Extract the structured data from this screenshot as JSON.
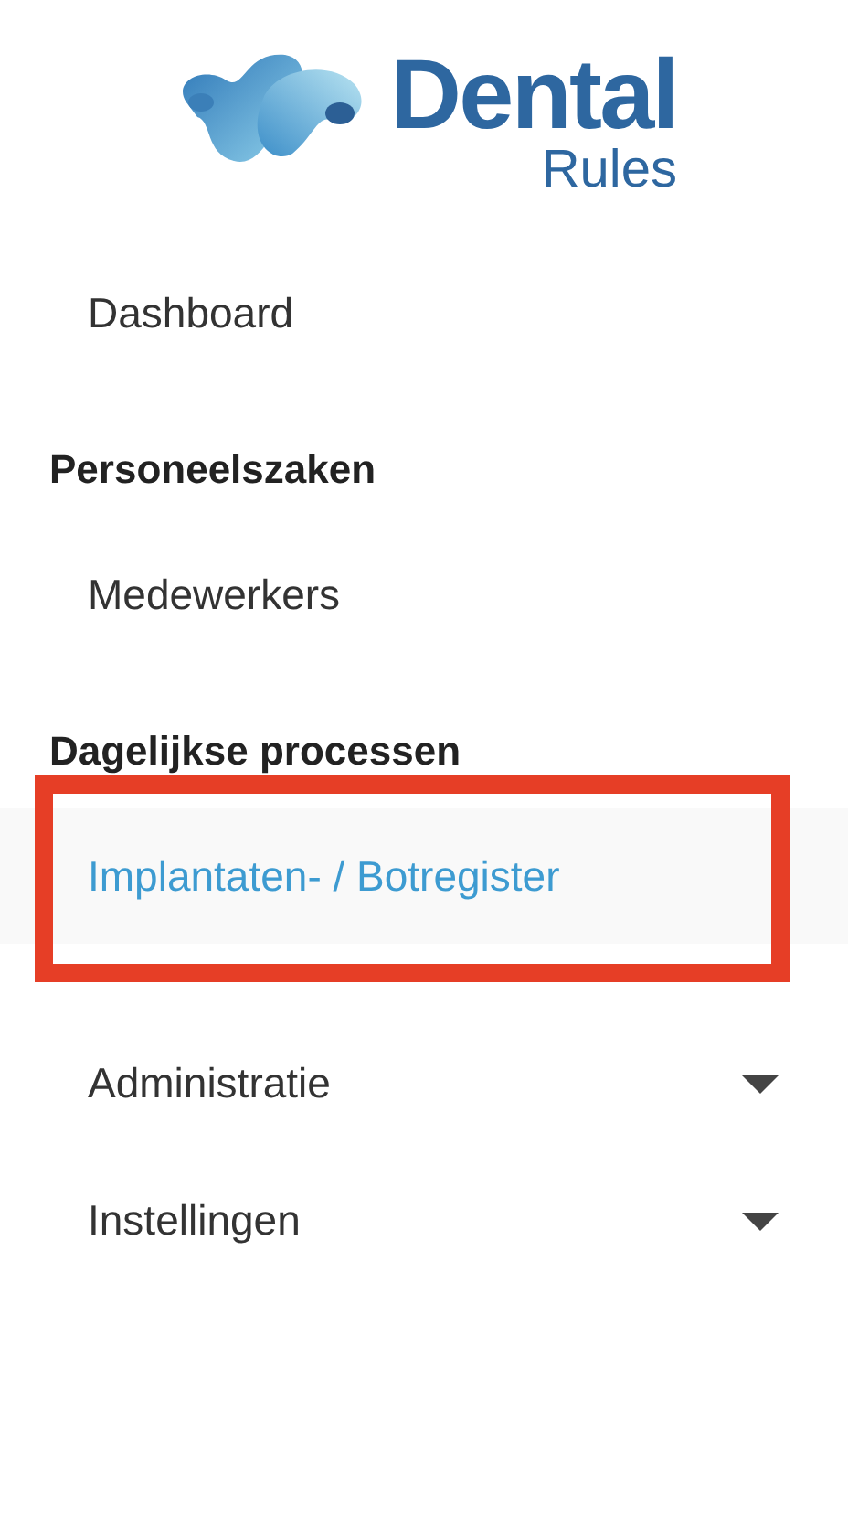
{
  "logo": {
    "title": "Dental",
    "subtitle": "Rules"
  },
  "nav": [
    {
      "kind": "link",
      "label": "Dashboard",
      "selected": false,
      "highlighted": false
    },
    {
      "kind": "heading",
      "label": "Personeelszaken"
    },
    {
      "kind": "link",
      "label": "Medewerkers",
      "selected": false,
      "highlighted": false
    },
    {
      "kind": "heading",
      "label": "Dagelijkse processen"
    },
    {
      "kind": "link",
      "label": "Implantaten- / Botregister",
      "selected": true,
      "highlighted": true
    }
  ],
  "menus": [
    {
      "label": "Administratie",
      "expanded": false
    },
    {
      "label": "Instellingen",
      "expanded": false
    }
  ]
}
